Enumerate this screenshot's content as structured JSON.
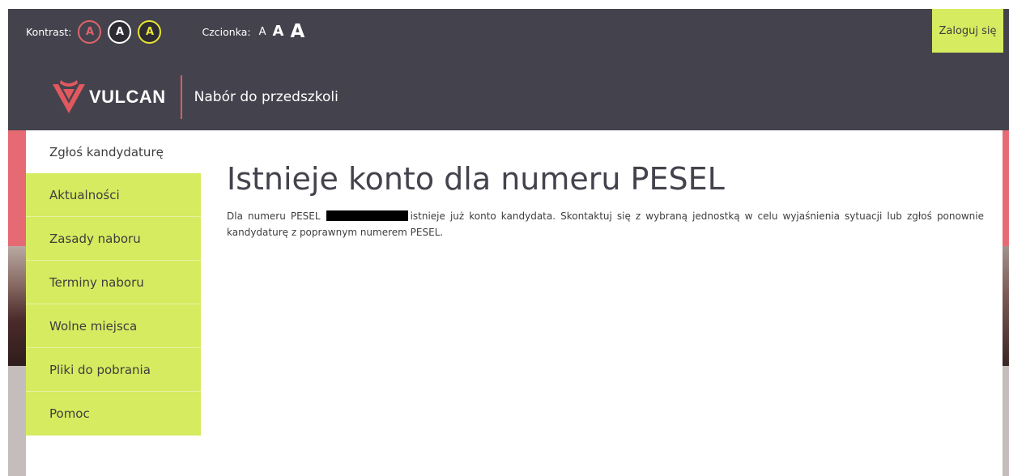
{
  "colors": {
    "header_bg": "#44434d",
    "accent_green": "#d6eb60",
    "accent_pink": "#e66a74",
    "brand_red": "#e2585f",
    "text_dark": "#3e3e3e"
  },
  "accessibility": {
    "contrast_label": "Kontrast:",
    "contrast_options": [
      "A",
      "A",
      "A"
    ],
    "font_label": "Czcionka:",
    "font_options": [
      "A",
      "A",
      "A"
    ]
  },
  "header": {
    "login_label": "Zaloguj się",
    "logo_text": "VULCAN",
    "logo_icon": "vulcan-shield-icon",
    "app_title": "Nabór do przedszkoli"
  },
  "sidebar": {
    "items": [
      {
        "label": "Zgłoś kandydaturę",
        "active": true
      },
      {
        "label": "Aktualności"
      },
      {
        "label": "Zasady naboru"
      },
      {
        "label": "Terminy naboru"
      },
      {
        "label": "Wolne miejsca"
      },
      {
        "label": "Pliki do pobrania"
      },
      {
        "label": "Pomoc"
      }
    ]
  },
  "main": {
    "title": "Istnieje konto dla numeru PESEL",
    "message_prefix": "Dla numeru PESEL",
    "message_suffix": "istnieje już konto kandydata. Skontaktuj się z wybraną jednostką w celu wyjaśnienia sytuacji lub zgłoś ponownie kandydaturę z poprawnym numerem PESEL."
  }
}
